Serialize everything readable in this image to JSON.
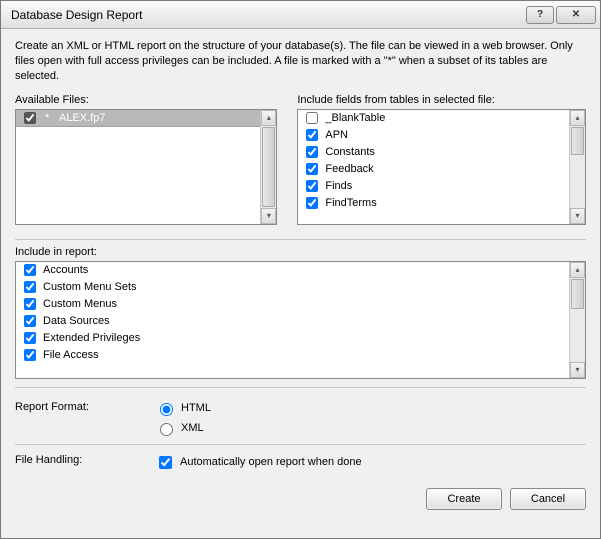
{
  "title": "Database Design Report",
  "intro": "Create an XML or HTML report on the structure of your database(s). The file can be viewed in a web browser. Only files open with full access privileges can be included. A file is marked with a \"*\" when a subset of its tables are selected.",
  "labels": {
    "available_files": "Available Files:",
    "include_fields": "Include fields from tables in selected file:",
    "include_in_report": "Include in report:",
    "report_format": "Report Format:",
    "file_handling": "File Handling:"
  },
  "files": [
    {
      "checked": true,
      "asterisk": "*",
      "name": "ALEX.fp7"
    }
  ],
  "tables": [
    {
      "checked": false,
      "name": "_BlankTable"
    },
    {
      "checked": true,
      "name": "APN"
    },
    {
      "checked": true,
      "name": "Constants"
    },
    {
      "checked": true,
      "name": "Feedback"
    },
    {
      "checked": true,
      "name": "Finds"
    },
    {
      "checked": true,
      "name": "FindTerms"
    }
  ],
  "report_items": [
    {
      "checked": true,
      "name": "Accounts"
    },
    {
      "checked": true,
      "name": "Custom Menu Sets"
    },
    {
      "checked": true,
      "name": "Custom Menus"
    },
    {
      "checked": true,
      "name": "Data Sources"
    },
    {
      "checked": true,
      "name": "Extended Privileges"
    },
    {
      "checked": true,
      "name": "File Access"
    }
  ],
  "report_format": {
    "html": "HTML",
    "xml": "XML",
    "selected": "HTML"
  },
  "file_handling": {
    "auto_open_label": "Automatically open report when done",
    "auto_open_checked": true
  },
  "buttons": {
    "create": "Create",
    "cancel": "Cancel"
  }
}
